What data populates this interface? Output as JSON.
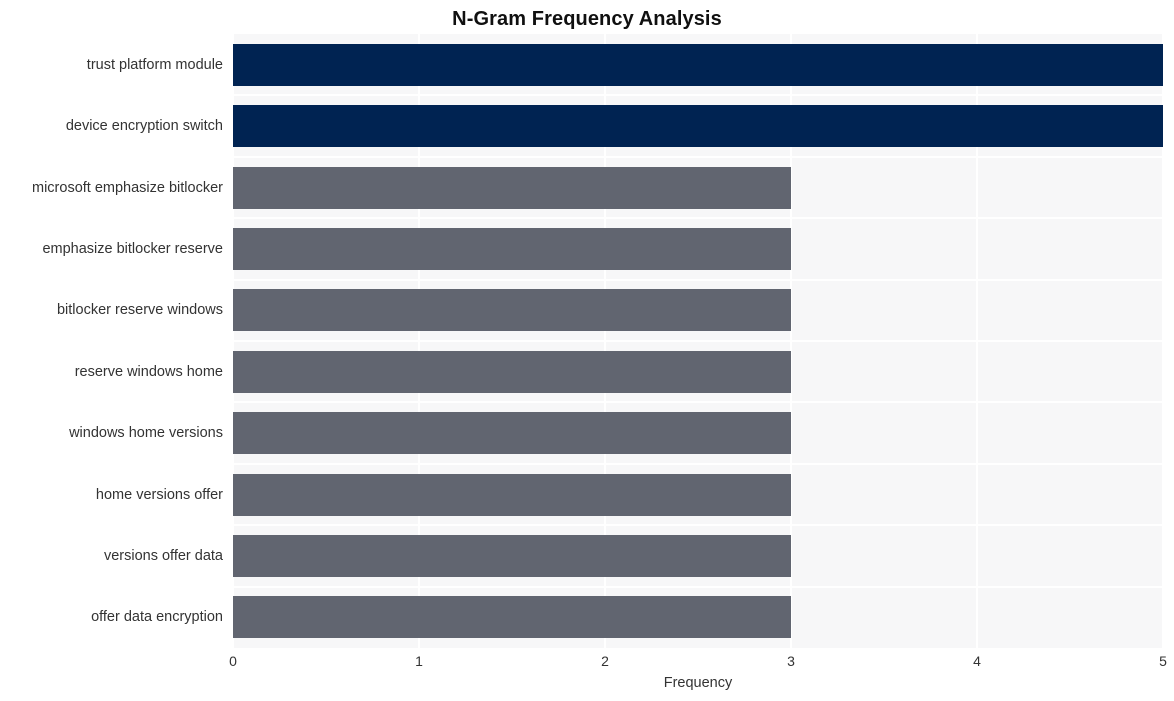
{
  "chart_data": {
    "type": "bar",
    "orientation": "horizontal",
    "title": "N-Gram Frequency Analysis",
    "xlabel": "Frequency",
    "ylabel": "",
    "xlim": [
      0,
      5
    ],
    "xticks": [
      "0",
      "1",
      "2",
      "3",
      "4",
      "5"
    ],
    "grid": true,
    "legend": "none",
    "categories": [
      "trust platform module",
      "device encryption switch",
      "microsoft emphasize bitlocker",
      "emphasize bitlocker reserve",
      "bitlocker reserve windows",
      "reserve windows home",
      "windows home versions",
      "home versions offer",
      "versions offer data",
      "offer data encryption"
    ],
    "values": [
      5,
      5,
      3,
      3,
      3,
      3,
      3,
      3,
      3,
      3
    ],
    "bar_colors": [
      "#002352",
      "#002352",
      "#616570",
      "#616570",
      "#616570",
      "#616570",
      "#616570",
      "#616570",
      "#616570",
      "#616570"
    ]
  },
  "style": {
    "plot_background": "#f7f7f8",
    "page_background": "#ffffff",
    "gridline_color": "#ffffff",
    "highlight_color": "#002352",
    "default_bar_color": "#616570",
    "text_color": "#333333",
    "title_color": "#101010"
  }
}
